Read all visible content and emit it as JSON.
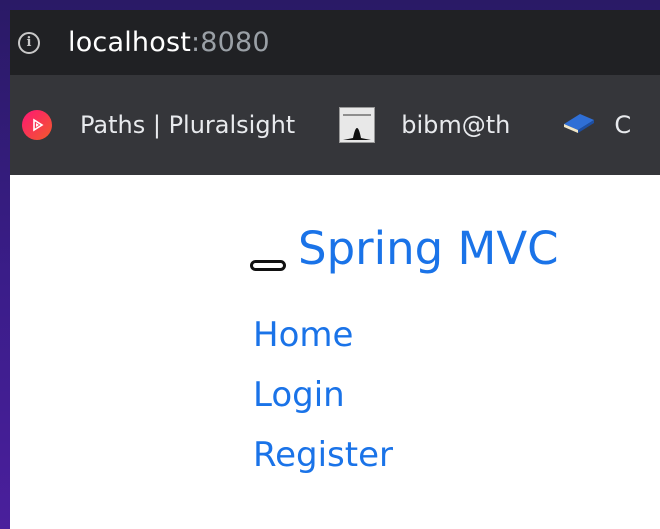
{
  "address_bar": {
    "host": "localhost",
    "port": ":8080"
  },
  "bookmarks": [
    {
      "label": "Paths | Pluralsight",
      "icon": "pluralsight-icon"
    },
    {
      "label": "bibm@th",
      "icon": "bibmath-icon"
    },
    {
      "label": "C",
      "icon": "book-icon"
    }
  ],
  "navbar": {
    "brand": "Spring MVC",
    "links": [
      "Home",
      "Login",
      "Register"
    ]
  },
  "colors": {
    "link": "#1a73e8",
    "addressbar_bg": "#202124",
    "bookmarks_bg": "#35363a",
    "pluralsight_brand": "#ff1675"
  }
}
